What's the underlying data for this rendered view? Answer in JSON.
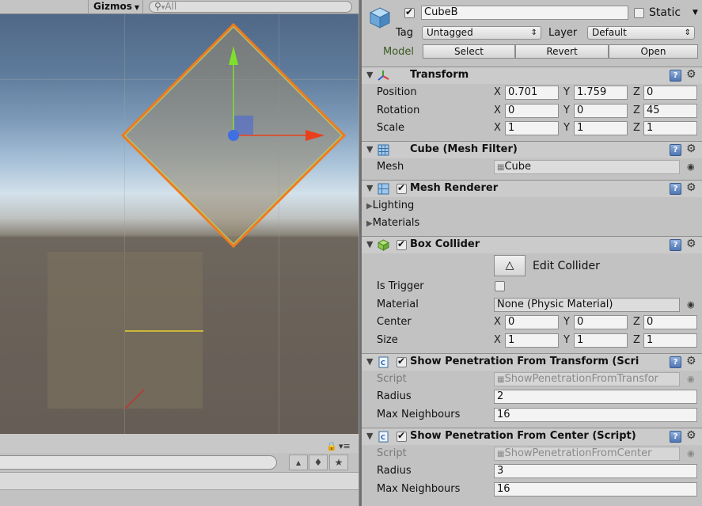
{
  "scene": {
    "gizmos_label": "Gizmos",
    "search_placeholder": "All"
  },
  "object": {
    "name": "CubeB",
    "active": true,
    "static_label": "Static",
    "tag_label": "Tag",
    "tag_value": "Untagged",
    "layer_label": "Layer",
    "layer_value": "Default",
    "model_label": "Model",
    "select_label": "Select",
    "revert_label": "Revert",
    "open_label": "Open"
  },
  "transform": {
    "title": "Transform",
    "position_label": "Position",
    "rotation_label": "Rotation",
    "scale_label": "Scale",
    "position": {
      "x": "0.701",
      "y": "1.759",
      "z": "0"
    },
    "rotation": {
      "x": "0",
      "y": "0",
      "z": "45"
    },
    "scale": {
      "x": "1",
      "y": "1",
      "z": "1"
    }
  },
  "axes": {
    "x": "X",
    "y": "Y",
    "z": "Z"
  },
  "mesh_filter": {
    "title": "Cube (Mesh Filter)",
    "mesh_label": "Mesh",
    "mesh_value": "Cube"
  },
  "mesh_renderer": {
    "title": "Mesh Renderer",
    "lighting_label": "Lighting",
    "materials_label": "Materials"
  },
  "box_collider": {
    "title": "Box Collider",
    "edit_label": "Edit Collider",
    "is_trigger_label": "Is Trigger",
    "material_label": "Material",
    "material_value": "None (Physic Material)",
    "center_label": "Center",
    "size_label": "Size",
    "center": {
      "x": "0",
      "y": "0",
      "z": "0"
    },
    "size": {
      "x": "1",
      "y": "1",
      "z": "1"
    }
  },
  "script_transform": {
    "title": "Show Penetration From Transform (Scri",
    "script_label": "Script",
    "script_value": "ShowPenetrationFromTransfor",
    "radius_label": "Radius",
    "radius_value": "2",
    "neighbours_label": "Max Neighbours",
    "neighbours_value": "16"
  },
  "script_center": {
    "title": "Show Penetration From Center (Script)",
    "script_label": "Script",
    "script_value": "ShowPenetrationFromCenter",
    "radius_label": "Radius",
    "radius_value": "3",
    "neighbours_label": "Max Neighbours",
    "neighbours_value": "16"
  },
  "colors": {
    "selection_outline": "#f07b1c",
    "axis_x": "#e8401c",
    "axis_y": "#7ee02a",
    "axis_z": "#3f6fe0",
    "help_icon": "#5a82c0"
  }
}
